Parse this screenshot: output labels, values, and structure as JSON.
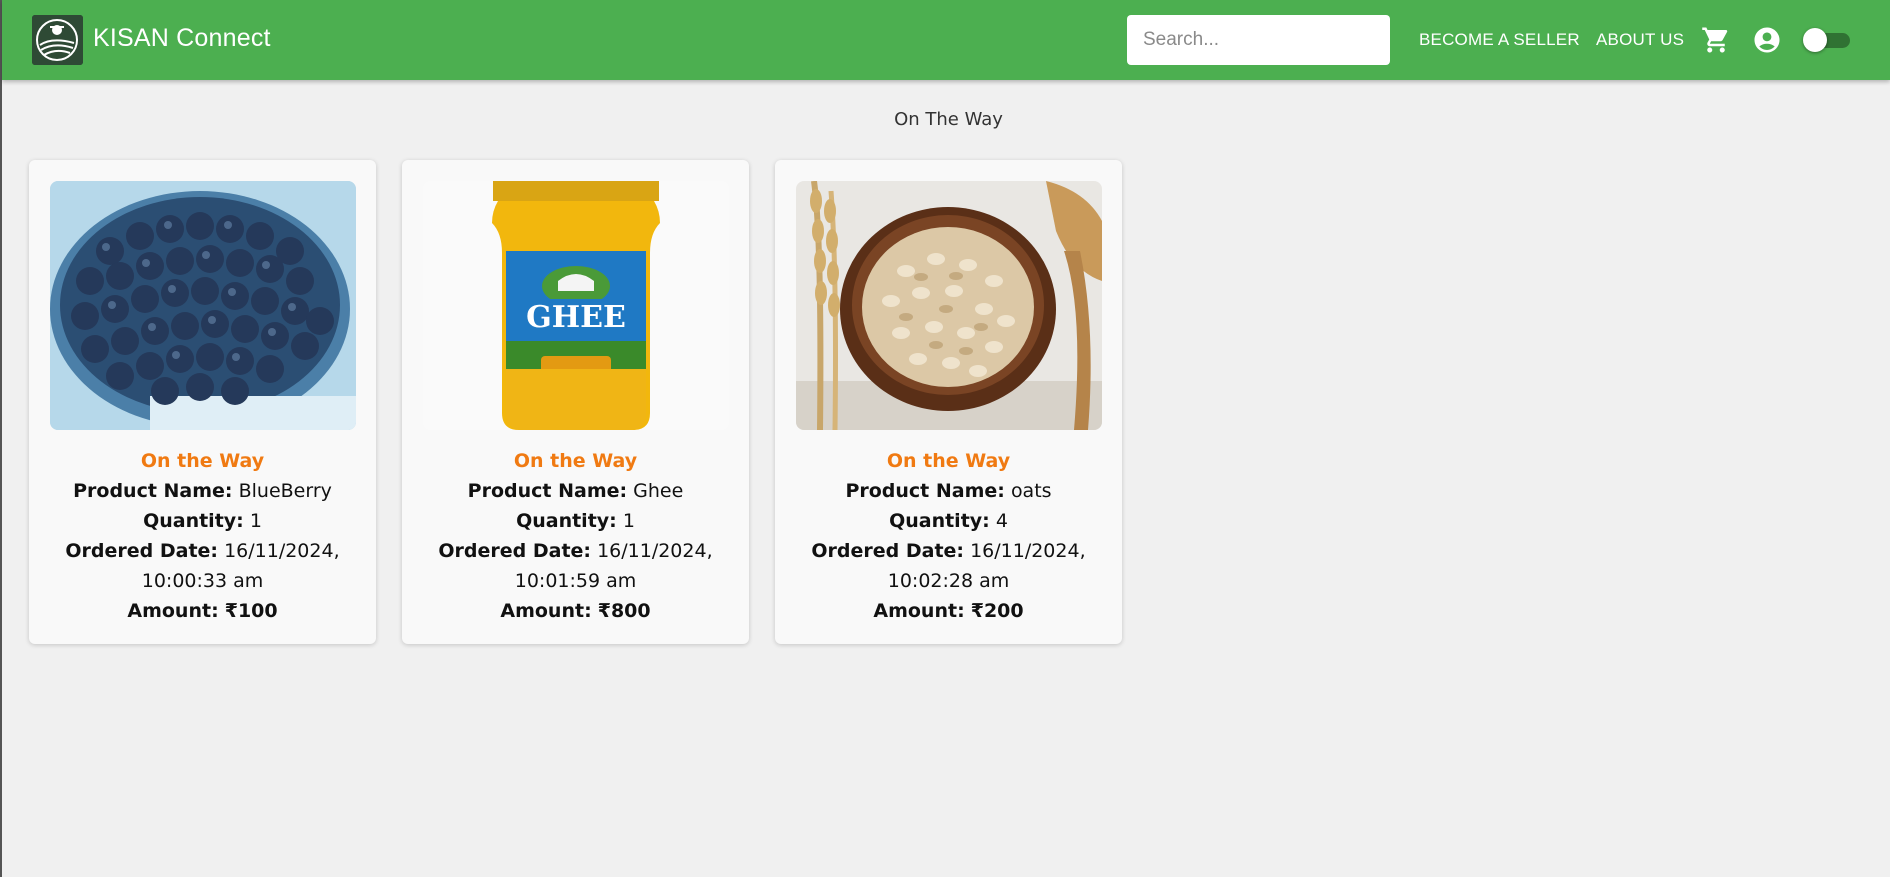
{
  "app": {
    "brand": "KISAN Connect",
    "search_placeholder": "Search...",
    "nav": {
      "become_seller": "BECOME A SELLER",
      "about_us": "ABOUT US"
    },
    "theme_color": "#4caf50",
    "icons": [
      "logo-icon",
      "cart-icon",
      "account-circle-icon",
      "theme-toggle"
    ]
  },
  "page": {
    "title": "On The Way"
  },
  "labels": {
    "product_name": "Product Name:",
    "quantity": "Quantity:",
    "ordered_date": "Ordered Date:",
    "amount": "Amount:"
  },
  "orders": [
    {
      "status": "On the Way",
      "product_name": "BlueBerry",
      "quantity": "1",
      "ordered_date": "16/11/2024, 10:00:33 am",
      "amount": "₹100",
      "image": "blueberries-bowl"
    },
    {
      "status": "On the Way",
      "product_name": "Ghee",
      "quantity": "1",
      "ordered_date": "16/11/2024, 10:01:59 am",
      "amount": "₹800",
      "image": "ghee-jar"
    },
    {
      "status": "On the Way",
      "product_name": "oats",
      "quantity": "4",
      "ordered_date": "16/11/2024, 10:02:28 am",
      "amount": "₹200",
      "image": "oats-bowl"
    }
  ],
  "colors": {
    "status": "#f07a12",
    "appbar": "#4caf50",
    "background": "#f0f0f0"
  }
}
